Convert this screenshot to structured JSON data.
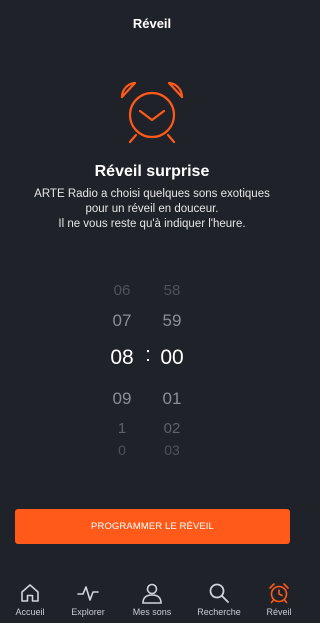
{
  "header": {
    "title": "Réveil"
  },
  "illustration": {
    "icon": "alarm-clock-icon",
    "color": "#ff5a1a"
  },
  "intro": {
    "title": "Réveil surprise",
    "lines": [
      "ARTE Radio a choisi quelques sons exotiques",
      "pour un réveil en douceur.",
      "Il ne vous reste qu'à indiquer l'heure."
    ]
  },
  "picker": {
    "hours": [
      "06",
      "07",
      "08",
      "09",
      "1",
      "0"
    ],
    "minutes": [
      "58",
      "59",
      "00",
      "01",
      "02",
      "03"
    ],
    "selected_hour": "08",
    "selected_minute": "00",
    "separator": ":"
  },
  "program_button": {
    "label": "PROGRAMMER LE RÉVEIL",
    "color": "#ff5a1a"
  },
  "tabbar": {
    "active": "Réveil",
    "active_color": "#ff5a1a",
    "tabs": [
      {
        "label": "Accueil",
        "icon": "home-icon"
      },
      {
        "label": "Explorer",
        "icon": "pulse-icon"
      },
      {
        "label": "Mes sons",
        "icon": "user-icon"
      },
      {
        "label": "Recherche",
        "icon": "search-icon"
      },
      {
        "label": "Réveil",
        "icon": "alarm-clock-icon"
      }
    ]
  }
}
